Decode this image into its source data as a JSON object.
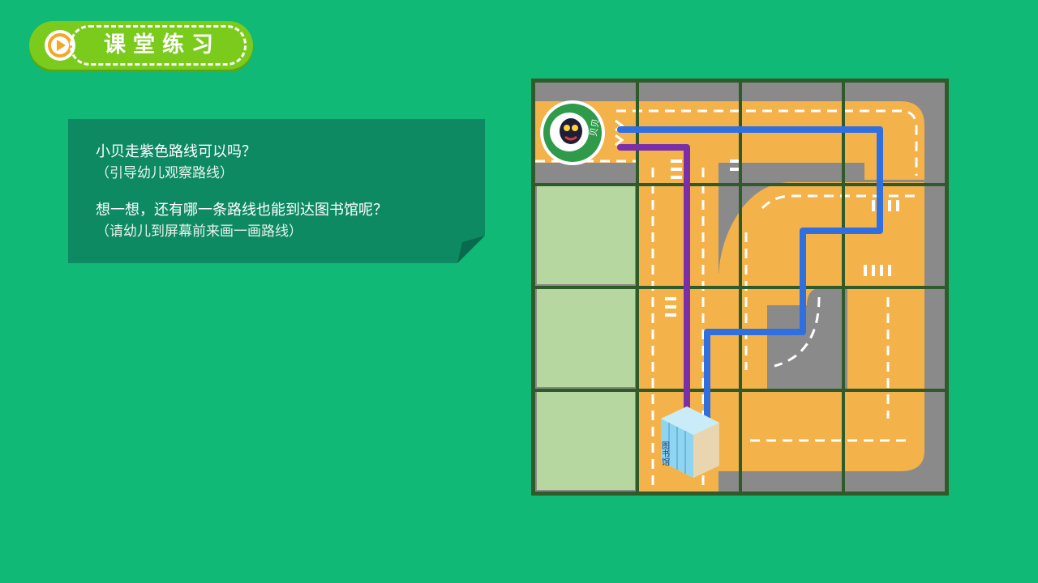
{
  "header": {
    "title": "课堂练习",
    "play_icon": "play-icon",
    "colors": {
      "badge": "#7acb1c",
      "icon": "#f5a623"
    }
  },
  "card": {
    "question1": "小贝走紫色路线可以吗？",
    "note1": "（引导幼儿观察路线）",
    "question2": "想一想，还有哪一条路线也能到达图书馆呢？",
    "note2": "（请幼儿到屏幕前来画一画路线）",
    "color": "#0e8a63"
  },
  "map": {
    "start_label": "贝贝",
    "library_label": "图书馆",
    "routes": [
      {
        "color": "#7a2fa8",
        "name": "purple"
      },
      {
        "color": "#2f6fe0",
        "name": "blue"
      }
    ]
  }
}
